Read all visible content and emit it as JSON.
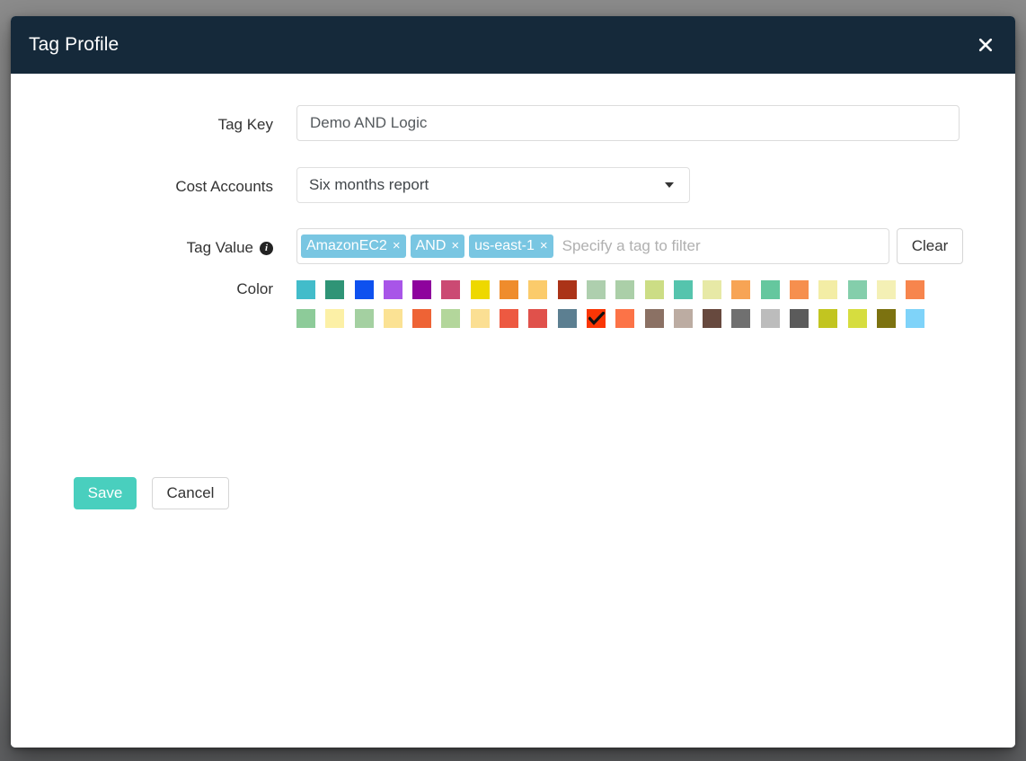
{
  "modal": {
    "title": "Tag Profile",
    "close_icon": "close-icon",
    "header_bg": "#15293a"
  },
  "form": {
    "tag_key": {
      "label": "Tag Key",
      "value": "Demo AND Logic",
      "placeholder": ""
    },
    "cost_accounts": {
      "label": "Cost Accounts",
      "selected": "Six months report",
      "caret_icon": "chevron-down-icon"
    },
    "tag_value": {
      "label": "Tag Value",
      "info_icon": "info-icon",
      "info_glyph": "i",
      "tokens": [
        {
          "text": "AmazonEC2",
          "remove_glyph": "×"
        },
        {
          "text": "AND",
          "remove_glyph": "×"
        },
        {
          "text": "us-east-1",
          "remove_glyph": "×"
        }
      ],
      "placeholder": "Specify a tag to filter",
      "input_value": "",
      "clear_label": "Clear",
      "token_color": "#79c6e2"
    },
    "color": {
      "label": "Color",
      "selected_index": 32,
      "selected_color": "#fa3605",
      "check_glyph": "✓",
      "swatches": [
        "#42bcca",
        "#2f9476",
        "#0e51ef",
        "#a855e8",
        "#8e039d",
        "#cb4a73",
        "#eed800",
        "#ef8c2c",
        "#fbcb6b",
        "#ab3318",
        "#aecfae",
        "#abcfa8",
        "#ccdd85",
        "#55c4ad",
        "#e7e9a6",
        "#f7a455",
        "#65c79e",
        "#f68f4e",
        "#f3eda5",
        "#84ceab",
        "#f4f0b5",
        "#f7854d",
        "#8dcb99",
        "#fcf0a6",
        "#a4d0a1",
        "#fbe294",
        "#ee6335",
        "#b3d69b",
        "#fbdf93",
        "#ed5941",
        "#e0514b",
        "#5c7f91",
        "#fa3605",
        "#fc7347",
        "#8b7164",
        "#bcaca2",
        "#67493e",
        "#707070",
        "#bcbcbc",
        "#5b5b5b",
        "#c2c520",
        "#d6dd3f",
        "#7c7210",
        "#7fd3f9"
      ]
    }
  },
  "actions": {
    "save_label": "Save",
    "cancel_label": "Cancel",
    "save_color": "#49cfbe"
  }
}
